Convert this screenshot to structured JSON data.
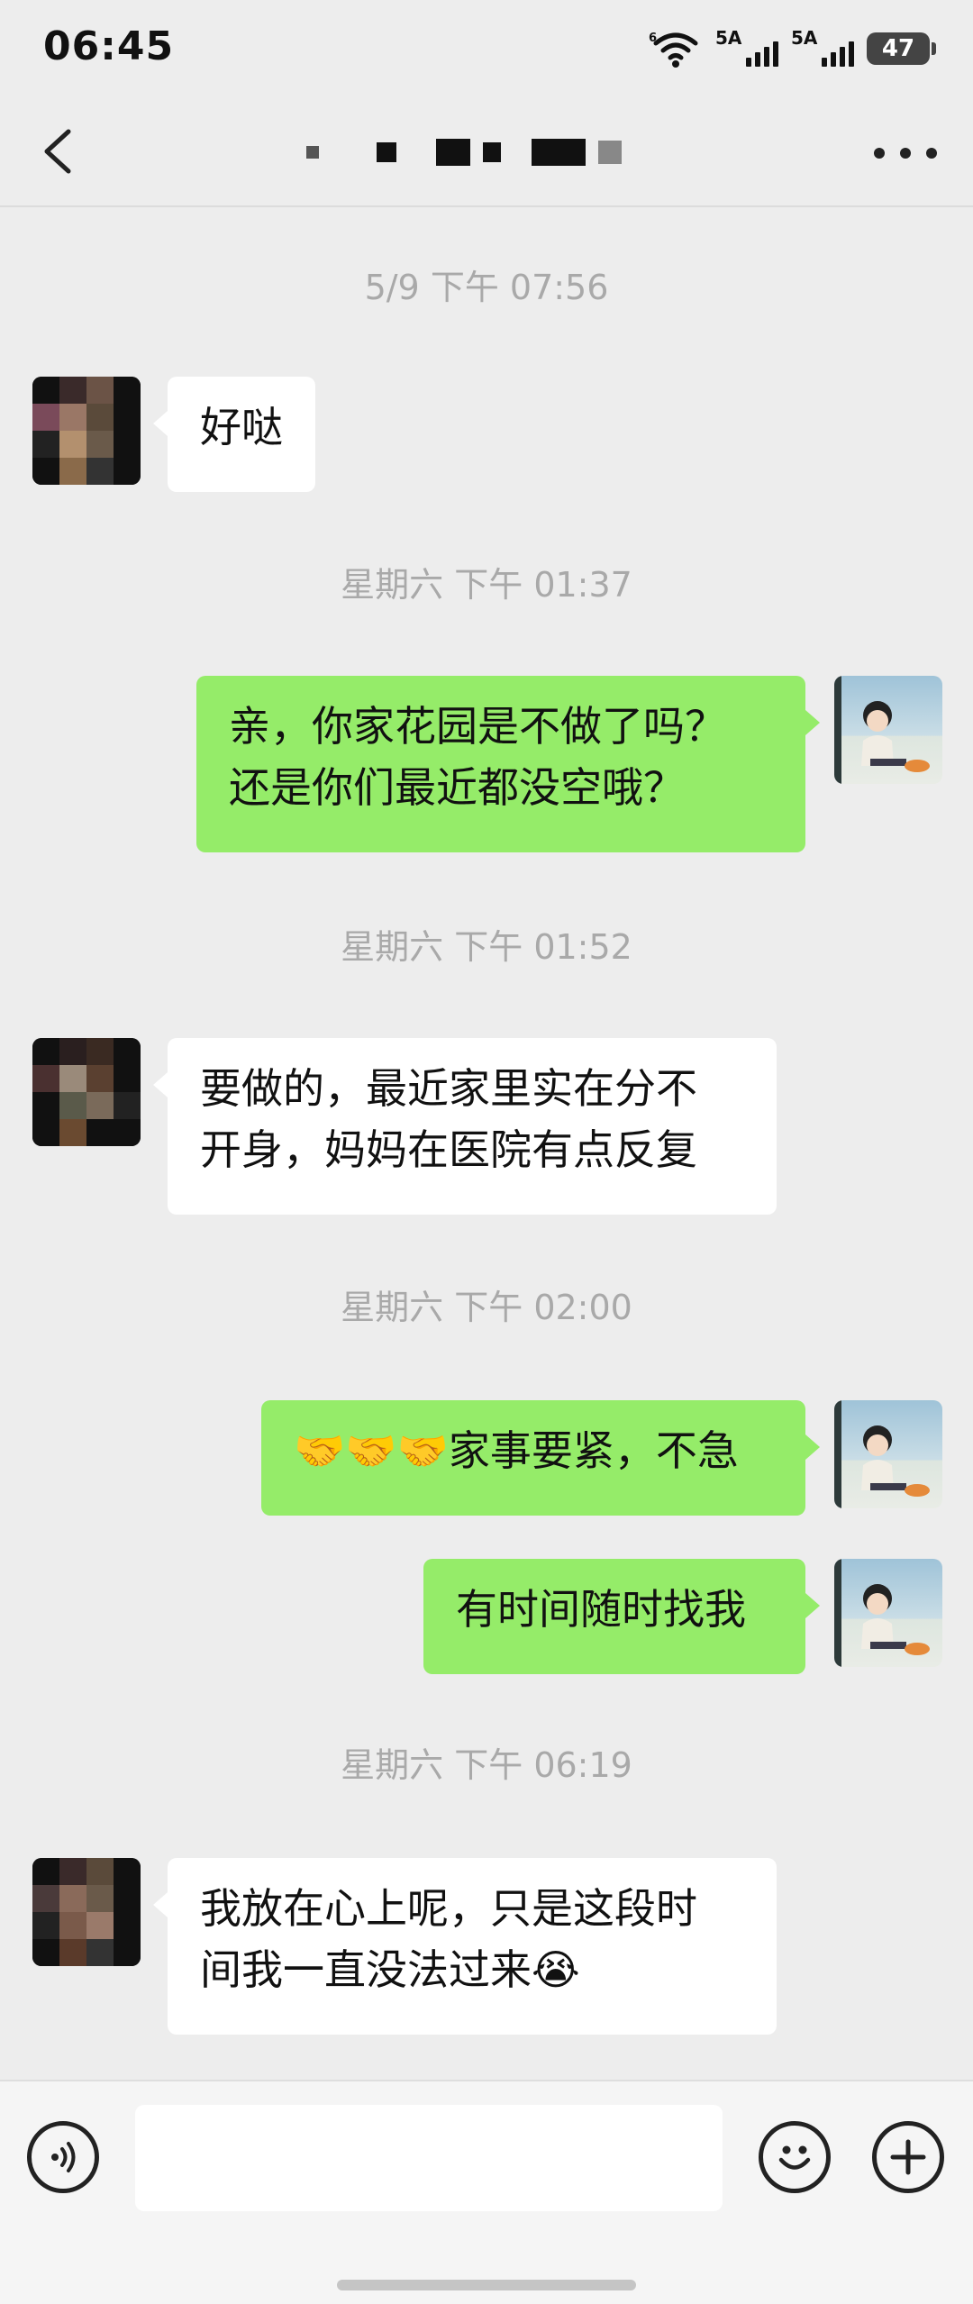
{
  "status_bar": {
    "time": "06:45",
    "signal1_label": "5A",
    "signal2_label": "5A",
    "battery": "47"
  },
  "header": {
    "back_icon": "chevron-left-icon",
    "more_icon": "more-dots-icon"
  },
  "messages": [
    {
      "type": "timestamp",
      "text": "5/9 下午 07:56"
    },
    {
      "type": "incoming",
      "lines": [
        "好哒"
      ]
    },
    {
      "type": "timestamp",
      "text": "星期六 下午 01:37"
    },
    {
      "type": "outgoing",
      "lines": [
        "亲，你家花园是不做了吗？",
        "还是你们最近都没空哦？"
      ]
    },
    {
      "type": "timestamp",
      "text": "星期六 下午 01:52"
    },
    {
      "type": "incoming",
      "lines": [
        "要做的，最近家里实在分不",
        "开身，妈妈在医院有点反复"
      ]
    },
    {
      "type": "timestamp",
      "text": "星期六 下午 02:00"
    },
    {
      "type": "outgoing",
      "lines": [
        "🤝🤝🤝家事要紧，不急"
      ]
    },
    {
      "type": "outgoing",
      "lines": [
        "有时间随时找我"
      ]
    },
    {
      "type": "timestamp",
      "text": "星期六 下午 06:19"
    },
    {
      "type": "incoming",
      "lines": [
        "我放在心上呢，只是这段时",
        "间我一直没法过来😭"
      ]
    }
  ],
  "input_bar": {
    "voice_icon": "voice-icon",
    "emoji_icon": "emoji-icon",
    "plus_icon": "plus-icon",
    "message_value": ""
  },
  "colors": {
    "background": "#ededed",
    "outgoing_bubble": "#95ec69",
    "incoming_bubble": "#ffffff",
    "timestamp_text": "#a9a9a9"
  }
}
